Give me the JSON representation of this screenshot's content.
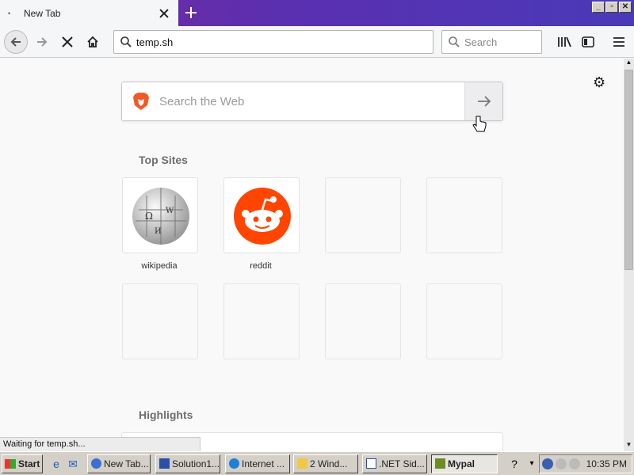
{
  "window": {
    "tab_title": "New Tab",
    "minimize_glyph": "_",
    "maximize_glyph": "▫",
    "close_glyph": "✕"
  },
  "navbar": {
    "url": "temp.sh",
    "search_placeholder": "Search"
  },
  "newtab": {
    "search_placeholder": "Search the Web",
    "top_sites_title": "Top Sites",
    "top_sites": [
      {
        "label": "wikipedia",
        "icon": "wikipedia-globe-icon"
      },
      {
        "label": "reddit",
        "icon": "reddit-alien-icon"
      }
    ],
    "highlights_title": "Highlights"
  },
  "status_text": "Waiting for temp.sh...",
  "taskbar": {
    "start_label": "Start",
    "tasks": [
      {
        "label": "New Tab...",
        "icon": "browser-icon"
      },
      {
        "label": "Solution1...",
        "icon": "visual-studio-icon"
      },
      {
        "label": "Internet ...",
        "icon": "internet-explorer-icon"
      },
      {
        "label": "2 Wind...",
        "icon": "folder-icon"
      },
      {
        "label": ".NET Sid...",
        "icon": "window-icon"
      },
      {
        "label": "Mypal",
        "icon": "mypal-icon",
        "active": true
      }
    ],
    "clock": "10:35 PM"
  },
  "colors": {
    "tabstrip_accent": "#6a2fb0",
    "reddit_orange": "#ff4500",
    "brave_orange": "#f15a24"
  }
}
